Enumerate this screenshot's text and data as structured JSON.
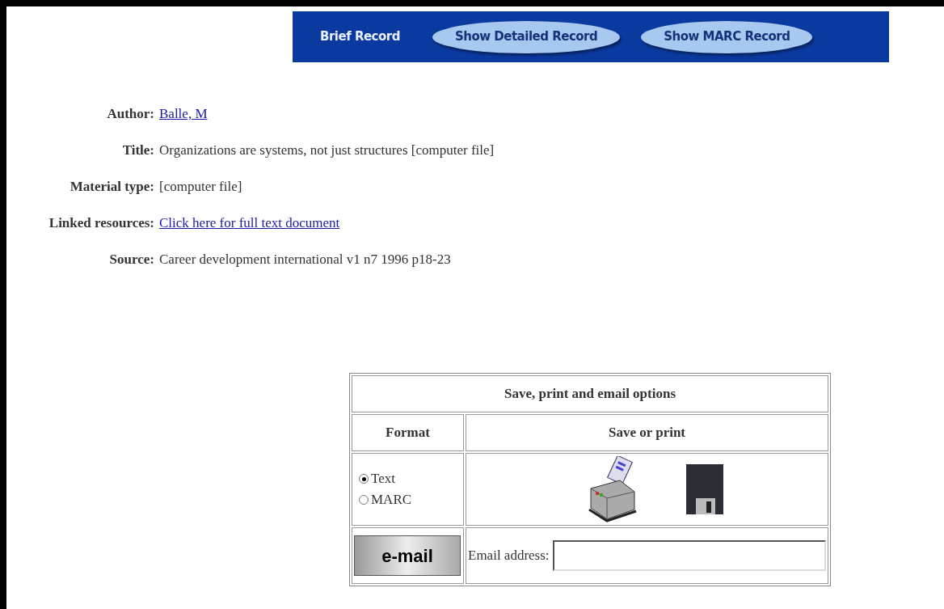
{
  "nav": [
    {
      "label": "Brief Record",
      "selected": true
    },
    {
      "label": "Show Detailed Record",
      "selected": false
    },
    {
      "label": "Show MARC Record",
      "selected": false
    }
  ],
  "fields": [
    {
      "label": "Author:",
      "value": "Balle, M",
      "kind": "link"
    },
    {
      "label": "Title:",
      "value": "Organizations are systems, not just structures [computer file]",
      "kind": "text"
    },
    {
      "label": "Material type:",
      "value": "[computer file]",
      "kind": "text"
    },
    {
      "label": "Linked resources:",
      "value": "Click here for full text document",
      "kind": "link"
    },
    {
      "label": "Source:",
      "value": "Career development international v1 n7 1996 p18-23",
      "kind": "text"
    }
  ],
  "options": {
    "title": "Save, print and email options",
    "format_heading": "Format",
    "save_heading": "Save or print",
    "formats": [
      {
        "label": "Text",
        "selected": true
      },
      {
        "label": "MARC",
        "selected": false
      }
    ],
    "email_button": "e-mail",
    "email_label": "Email address:"
  }
}
